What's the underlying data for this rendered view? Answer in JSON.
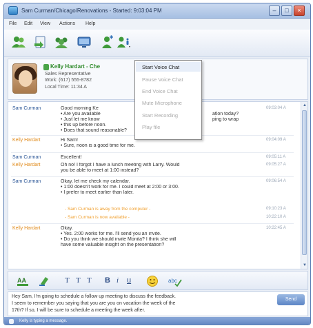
{
  "window": {
    "title": "Sam Curman/Chicago/Renovations - Started: 9:03:04 PM"
  },
  "menubar": {
    "items": [
      "File",
      "Edit",
      "View",
      "Actions",
      "Help"
    ]
  },
  "toolbar": {
    "icons": [
      "people-icon",
      "document-icon",
      "group-icon",
      "screen-share-icon",
      "person-add-icon",
      "voice-chat-icon"
    ]
  },
  "profile": {
    "name": "Kelly Hardart - Che",
    "title": "Sales Representative",
    "work": "Work: (617) 555-8782",
    "local_time": "Local Time: 11:34 A"
  },
  "voice_menu": {
    "items": [
      {
        "label": "Start Voice Chat",
        "enabled": true
      },
      {
        "label": "Pause Voice Chat",
        "enabled": false
      },
      {
        "label": "End Voice Chat",
        "enabled": false
      },
      {
        "label": "Mute Microphone",
        "enabled": false
      },
      {
        "label": "Start Recording",
        "enabled": false
      },
      {
        "label": "Play file",
        "enabled": false
      }
    ]
  },
  "messages": [
    {
      "sender": "Sam Curman",
      "role": "sam",
      "time": "09:03:04 A",
      "lines": [
        "Good morning Ke",
        "• Are you available",
        "• Just let me know",
        "• this up before noon.",
        "• Does that sound reasonable?"
      ],
      "overlap": "ation today?\nping to wrap"
    },
    {
      "sender": "Kelly Hardart",
      "role": "kelly",
      "time": "09:04:09 A",
      "lines": [
        "Hi Sam!",
        "• Sure, noon is a good time for me."
      ]
    },
    {
      "sender": "Sam Curman",
      "role": "sam",
      "time": "09:05:11 A",
      "lines": [
        "Excellent!"
      ]
    },
    {
      "sender": "Kelly Hardart",
      "role": "kelly",
      "time": "09:05:27 A",
      "lines": [
        "Oh no! I forgot I have a lunch meeting with Larry. Would",
        "you be able to meet at 1:00 instead?"
      ]
    },
    {
      "sender": "Sam Curman",
      "role": "sam",
      "time": "09:06:54 A",
      "lines": [
        "Okay, let me check my calendar.",
        "• 1:00 doesn't work for me. I could meet at 2:00 or 3:00.",
        "• I prefer to meet earlier than later."
      ]
    }
  ],
  "status_lines": [
    {
      "text": "- Sam Curman is away from the computer -",
      "time": "09:10:23 A"
    },
    {
      "text": "- Sam Curman is now available -",
      "time": "10:22:10 A"
    }
  ],
  "final_message": {
    "sender": "Kelly Hardart",
    "role": "kelly",
    "time": "10:22:45 A",
    "lines": [
      "Okay.",
      "• Yes. 2:00 works for me. I'll send you an invite.",
      "• Do you think we should invite Monita? I think she will",
      "  have some valuable insight on the presentation?"
    ]
  },
  "format_bar": {
    "items": [
      "font-color-icon",
      "highlight-icon",
      "T",
      "T",
      "T",
      "B",
      "i",
      "u",
      "emoticon-icon",
      "spellcheck-icon"
    ]
  },
  "compose": {
    "lines": [
      "Hey Sam, I'm going to schedule a follow up meeting to discuss the feedback.",
      "I seem to remember you saying that you are you on vacation the week of the",
      "17th? If so, I will be sure to schedule a meeting the week after."
    ],
    "send_label": "Send"
  },
  "statusbar": {
    "text": "Kelly is typing a message."
  }
}
